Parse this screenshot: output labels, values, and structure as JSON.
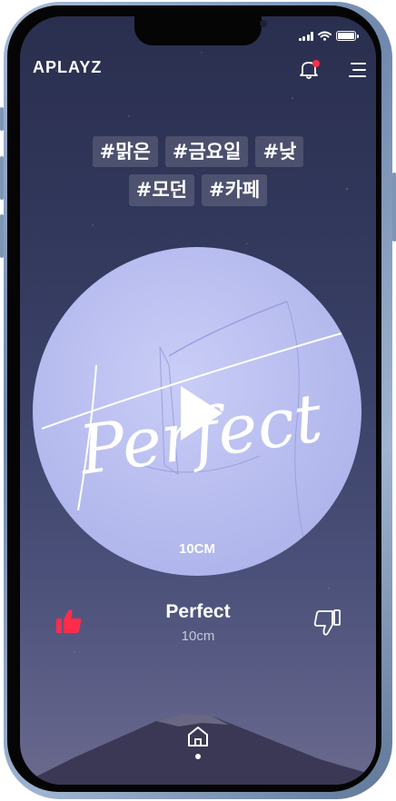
{
  "app": {
    "logo": "APLAYZ"
  },
  "header": {
    "notification_icon": "bell-icon",
    "menu_icon": "hamburger-menu-icon",
    "notification_dot_color": "#ff2d4b"
  },
  "tags": [
    "#맑은",
    "#금요일",
    "#낮",
    "#모던",
    "#카페"
  ],
  "album": {
    "cover_script": "Perfect",
    "cover_artist": "10CM",
    "play_icon": "play-icon"
  },
  "track": {
    "title": "Perfect",
    "artist": "10cm"
  },
  "actions": {
    "like_icon": "thumbs-up-icon",
    "dislike_icon": "thumbs-down-icon",
    "like_color": "#ff2d4b"
  },
  "nav": {
    "home_icon": "home-icon"
  }
}
